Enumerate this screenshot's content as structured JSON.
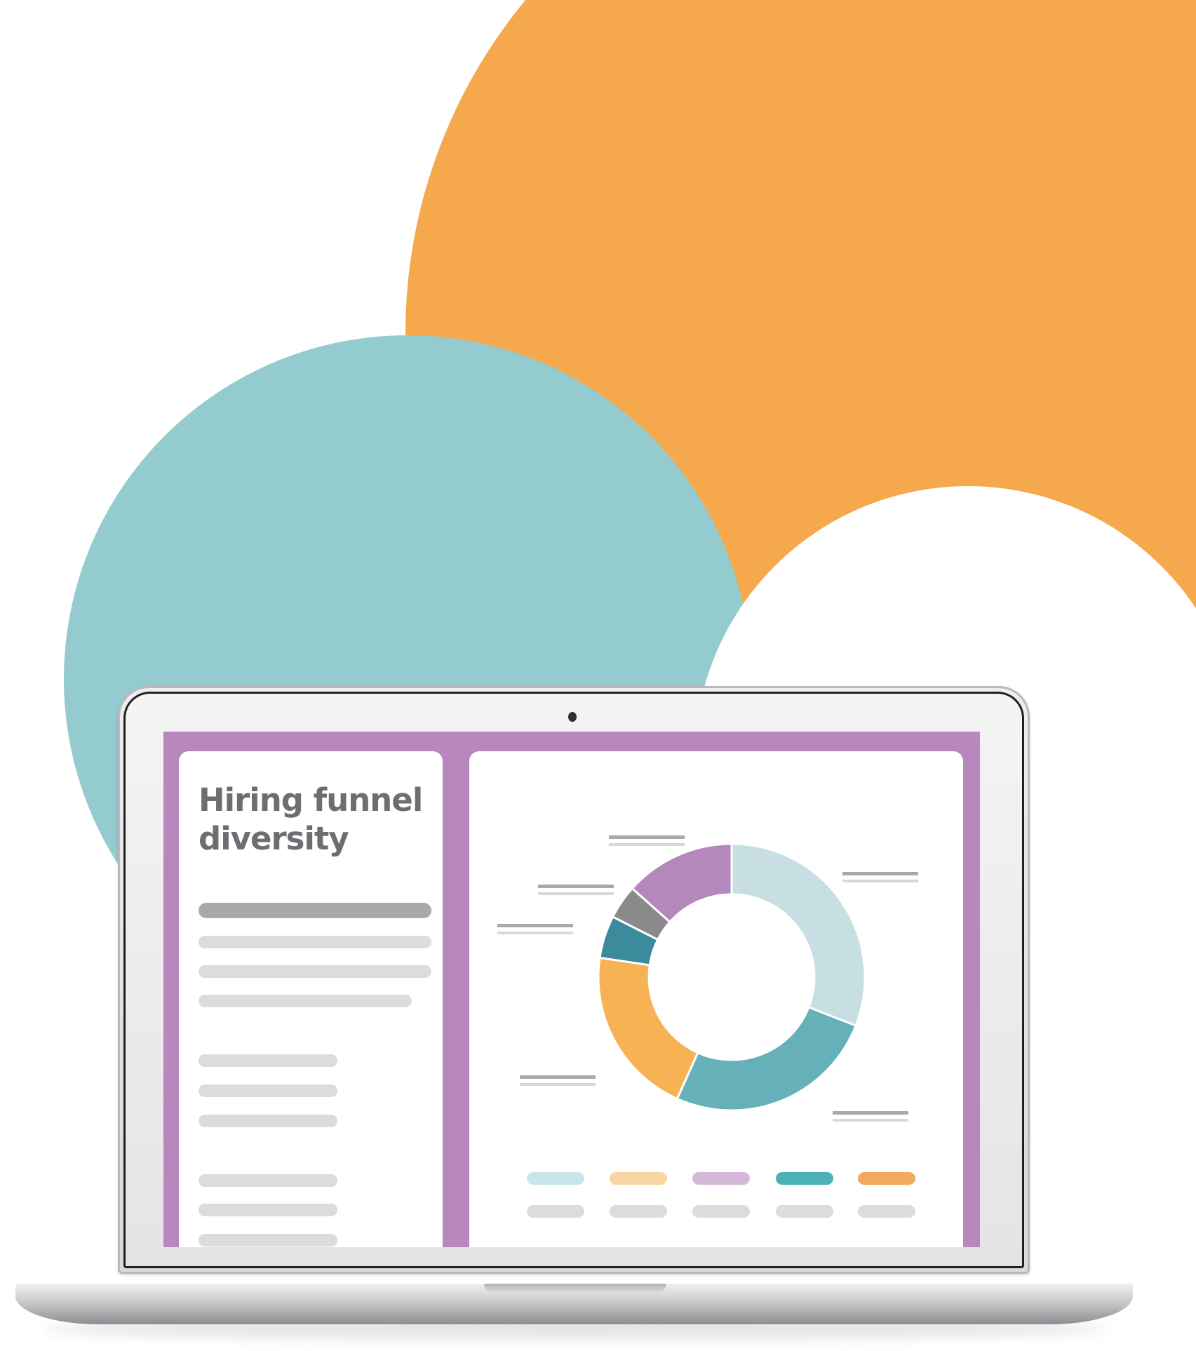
{
  "colors": {
    "orange": "#f6a84d",
    "teal_bg": "#93cbce",
    "screen_frame": "#b887bd",
    "title": "#6c6e72"
  },
  "page": {
    "title": "Hiring funnel diversity"
  },
  "chart_data": {
    "type": "pie",
    "variant": "donut",
    "title": "",
    "values": [
      30,
      25,
      20,
      5,
      4,
      13
    ],
    "colors": [
      "#c7dfe3",
      "#66b1b9",
      "#f7b254",
      "#3b8b9c",
      "#8a8a8a",
      "#b588bc"
    ],
    "legend": {
      "placement": "bottom",
      "colors": [
        "#c9e4ea",
        "#f9d4a5",
        "#d5b7d9",
        "#4bb0b8",
        "#f2a95e"
      ]
    }
  }
}
